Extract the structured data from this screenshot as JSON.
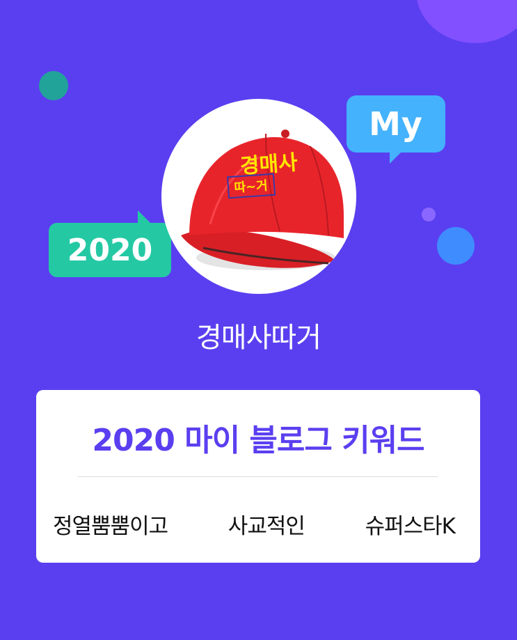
{
  "badges": {
    "my": "My",
    "year": "2020"
  },
  "avatar": {
    "cap_text_top": "경매사",
    "cap_text_bottom": "따~거"
  },
  "profile": {
    "nickname": "경매사따거"
  },
  "card": {
    "title": "2020 마이 블로그 키워드",
    "keywords": [
      "정열뿜뿜이고",
      "사교적인",
      "슈퍼스타K"
    ]
  },
  "colors": {
    "background": "#5a3ff0",
    "accent": "#5a3ff0",
    "my_bubble": "#44b2fc",
    "year_bubble": "#24c9a4",
    "cap": "#e8242b",
    "cap_text": "#ffe600"
  }
}
